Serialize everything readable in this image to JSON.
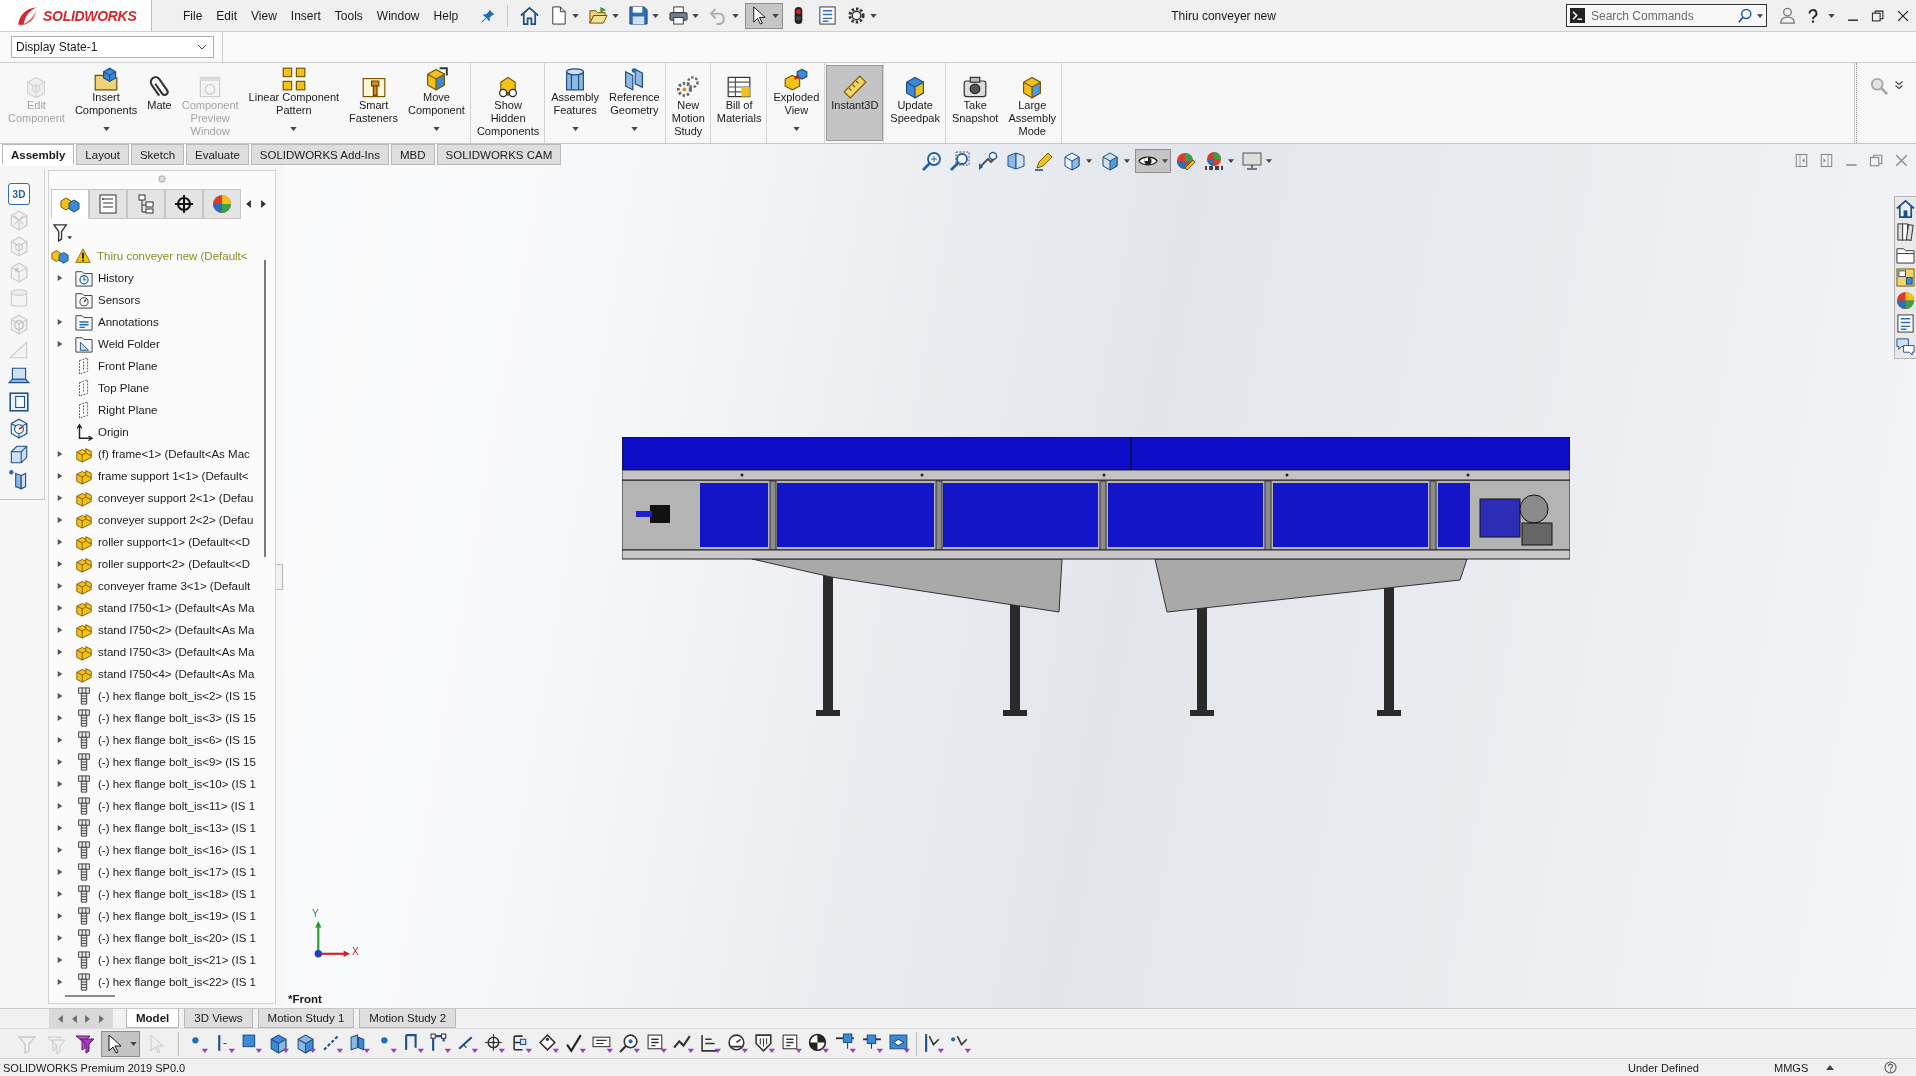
{
  "titlebar": {
    "logo": "SOLIDWORKS",
    "menu": [
      "File",
      "Edit",
      "View",
      "Insert",
      "Tools",
      "Window",
      "Help"
    ],
    "quick_access": [
      {
        "dropdown": false,
        "disabled": false,
        "selected": false
      },
      {
        "dropdown": true,
        "disabled": false,
        "selected": false
      },
      {
        "dropdown": true,
        "disabled": false,
        "selected": false
      },
      {
        "dropdown": true,
        "disabled": false,
        "selected": false
      },
      {
        "dropdown": true,
        "disabled": false,
        "selected": false
      },
      {
        "dropdown": true,
        "disabled": true,
        "selected": false
      },
      {
        "dropdown": true,
        "disabled": false,
        "selected": true
      },
      {
        "dropdown": false,
        "disabled": false,
        "selected": false
      },
      {
        "dropdown": false,
        "disabled": false,
        "selected": false
      },
      {
        "dropdown": true,
        "disabled": false,
        "selected": false
      }
    ],
    "title": "Thiru conveyer new",
    "search": {
      "placeholder": "Search Commands"
    }
  },
  "display_state": {
    "value": "Display State-1"
  },
  "ribbon": {
    "groups": [
      [
        {
          "lines": [
            "Edit",
            "Component"
          ],
          "disabled": true,
          "dropdown": false,
          "selected": false
        },
        {
          "lines": [
            "Insert",
            "Components"
          ],
          "disabled": false,
          "dropdown": true,
          "selected": false
        },
        {
          "lines": [
            "Mate"
          ],
          "disabled": false,
          "dropdown": false,
          "selected": false
        },
        {
          "lines": [
            "Component",
            "Preview",
            "Window"
          ],
          "disabled": true,
          "dropdown": false,
          "selected": false
        },
        {
          "lines": [
            "Linear Component",
            "Pattern"
          ],
          "disabled": false,
          "dropdown": true,
          "selected": false
        },
        {
          "lines": [
            "Smart",
            "Fasteners"
          ],
          "disabled": false,
          "dropdown": false,
          "selected": false
        },
        {
          "lines": [
            "Move",
            "Component"
          ],
          "disabled": false,
          "dropdown": true,
          "selected": false
        }
      ],
      [
        {
          "lines": [
            "Show",
            "Hidden",
            "Components"
          ],
          "disabled": false,
          "dropdown": false,
          "selected": false
        }
      ],
      [
        {
          "lines": [
            "Assembly",
            "Features"
          ],
          "disabled": false,
          "dropdown": true,
          "selected": false
        },
        {
          "lines": [
            "Reference",
            "Geometry"
          ],
          "disabled": false,
          "dropdown": true,
          "selected": false
        }
      ],
      [
        {
          "lines": [
            "New",
            "Motion",
            "Study"
          ],
          "disabled": false,
          "dropdown": false,
          "selected": false
        }
      ],
      [
        {
          "lines": [
            "Bill of",
            "Materials"
          ],
          "disabled": false,
          "dropdown": false,
          "selected": false
        }
      ],
      [
        {
          "lines": [
            "Exploded",
            "View"
          ],
          "disabled": false,
          "dropdown": true,
          "selected": false
        }
      ],
      [
        {
          "lines": [
            "Instant3D"
          ],
          "disabled": false,
          "dropdown": false,
          "selected": true
        }
      ],
      [
        {
          "lines": [
            "Update",
            "Speedpak"
          ],
          "disabled": false,
          "dropdown": false,
          "selected": false
        }
      ],
      [
        {
          "lines": [
            "Take",
            "Snapshot"
          ],
          "disabled": false,
          "dropdown": false,
          "selected": false
        },
        {
          "lines": [
            "Large",
            "Assembly",
            "Mode"
          ],
          "disabled": false,
          "dropdown": false,
          "selected": false
        }
      ]
    ]
  },
  "command_tabs": [
    {
      "label": "Assembly",
      "selected": true
    },
    {
      "label": "Layout",
      "selected": false
    },
    {
      "label": "Sketch",
      "selected": false
    },
    {
      "label": "Evaluate",
      "selected": false
    },
    {
      "label": "SOLIDWORKS Add-Ins",
      "selected": false
    },
    {
      "label": "MBD",
      "selected": false
    },
    {
      "label": "SOLIDWORKS CAM",
      "selected": false
    }
  ],
  "left_toolbar": [
    {
      "label": "3D",
      "disabled": false
    },
    {
      "disabled": true
    },
    {
      "disabled": true
    },
    {
      "disabled": true
    },
    {
      "disabled": true
    },
    {
      "disabled": true
    },
    {
      "disabled": true
    },
    {
      "disabled": false
    },
    {
      "disabled": false
    },
    {
      "disabled": false
    },
    {
      "disabled": false
    },
    {
      "disabled": false
    }
  ],
  "feature_manager": {
    "tabs": [
      {
        "selected": true
      },
      {
        "selected": false
      },
      {
        "selected": false
      },
      {
        "selected": false
      },
      {
        "selected": false
      }
    ],
    "tree": {
      "label": "Thiru conveyer new (Default<",
      "kind": "assembly",
      "warning": true,
      "children": [
        {
          "label": "History",
          "kind": "history",
          "expandable": true
        },
        {
          "label": "Sensors",
          "kind": "sensors",
          "expandable": false
        },
        {
          "label": "Annotations",
          "kind": "annotations",
          "expandable": true
        },
        {
          "label": "Weld Folder",
          "kind": "weld",
          "expandable": true
        },
        {
          "label": "Front Plane",
          "kind": "plane",
          "expandable": false
        },
        {
          "label": "Top Plane",
          "kind": "plane",
          "expandable": false
        },
        {
          "label": "Right Plane",
          "kind": "plane",
          "expandable": false
        },
        {
          "label": "Origin",
          "kind": "origin",
          "expandable": false
        },
        {
          "label": "(f) frame<1> (Default<As Mac",
          "kind": "part",
          "expandable": true
        },
        {
          "label": "frame support 1<1> (Default<",
          "kind": "part",
          "expandable": true
        },
        {
          "label": "conveyer support 2<1> (Defau",
          "kind": "part",
          "expandable": true
        },
        {
          "label": "conveyer support 2<2> (Defau",
          "kind": "part",
          "expandable": true
        },
        {
          "label": "roller support<1> (Default<<D",
          "kind": "part",
          "expandable": true
        },
        {
          "label": "roller support<2> (Default<<D",
          "kind": "part",
          "expandable": true
        },
        {
          "label": "conveyer frame 3<1> (Default",
          "kind": "part",
          "expandable": true
        },
        {
          "label": "stand I750<1> (Default<As Ma",
          "kind": "part",
          "expandable": true
        },
        {
          "label": "stand I750<2> (Default<As Ma",
          "kind": "part",
          "expandable": true
        },
        {
          "label": "stand I750<3> (Default<As Ma",
          "kind": "part",
          "expandable": true
        },
        {
          "label": "stand I750<4> (Default<As Ma",
          "kind": "part",
          "expandable": true
        },
        {
          "label": "(-) hex flange bolt_is<2> (IS 15",
          "kind": "bolt",
          "expandable": true
        },
        {
          "label": "(-) hex flange bolt_is<3> (IS 15",
          "kind": "bolt",
          "expandable": true
        },
        {
          "label": "(-) hex flange bolt_is<6> (IS 15",
          "kind": "bolt",
          "expandable": true
        },
        {
          "label": "(-) hex flange bolt_is<9> (IS 15",
          "kind": "bolt",
          "expandable": true
        },
        {
          "label": "(-) hex flange bolt_is<10> (IS 1",
          "kind": "bolt",
          "expandable": true
        },
        {
          "label": "(-) hex flange bolt_is<11> (IS 1",
          "kind": "bolt",
          "expandable": true
        },
        {
          "label": "(-) hex flange bolt_is<13> (IS 1",
          "kind": "bolt",
          "expandable": true
        },
        {
          "label": "(-) hex flange bolt_is<16> (IS 1",
          "kind": "bolt",
          "expandable": true
        },
        {
          "label": "(-) hex flange bolt_is<17> (IS 1",
          "kind": "bolt",
          "expandable": true
        },
        {
          "label": "(-) hex flange bolt_is<18> (IS 1",
          "kind": "bolt",
          "expandable": true
        },
        {
          "label": "(-) hex flange bolt_is<19> (IS 1",
          "kind": "bolt",
          "expandable": true
        },
        {
          "label": "(-) hex flange bolt_is<20> (IS 1",
          "kind": "bolt",
          "expandable": true
        },
        {
          "label": "(-) hex flange bolt_is<21> (IS 1",
          "kind": "bolt",
          "expandable": true
        },
        {
          "label": "(-) hex flange bolt_is<22> (IS 1",
          "kind": "bolt",
          "expandable": true
        }
      ]
    }
  },
  "view_toolbar": [
    {
      "dropdown": false,
      "selected": false
    },
    {
      "dropdown": false,
      "selected": false
    },
    {
      "dropdown": false,
      "selected": false
    },
    {
      "dropdown": false,
      "selected": false
    },
    {
      "dropdown": false,
      "selected": false
    },
    {
      "dropdown": true,
      "selected": false
    },
    {
      "dropdown": true,
      "selected": false
    },
    {
      "dropdown": true,
      "selected": true
    },
    {
      "dropdown": false,
      "selected": false
    },
    {
      "dropdown": true,
      "selected": false
    },
    {
      "dropdown": true,
      "selected": false
    }
  ],
  "viewport": {
    "triad": {
      "y_label": "Y",
      "x_label": "X"
    },
    "view_name": "*Front"
  },
  "bottom_tabs": [
    {
      "label": "Model",
      "selected": true
    },
    {
      "label": "3D Views",
      "selected": false
    },
    {
      "label": "Motion Study 1",
      "selected": false
    },
    {
      "label": "Motion Study 2",
      "selected": false
    }
  ],
  "selection_toolbar": [
    {
      "disabled": true,
      "selected": false,
      "dropdown": false
    },
    {
      "disabled": true,
      "selected": false,
      "dropdown": false
    },
    {
      "disabled": false,
      "selected": false,
      "dropdown": false
    },
    {
      "disabled": false,
      "selected": true,
      "dropdown": true
    },
    {
      "disabled": true,
      "selected": false,
      "dropdown": false
    }
  ],
  "status_bar": {
    "product": "SOLIDWORKS Premium 2019 SP0.0",
    "state": "Under Defined",
    "units": "MMGS"
  }
}
